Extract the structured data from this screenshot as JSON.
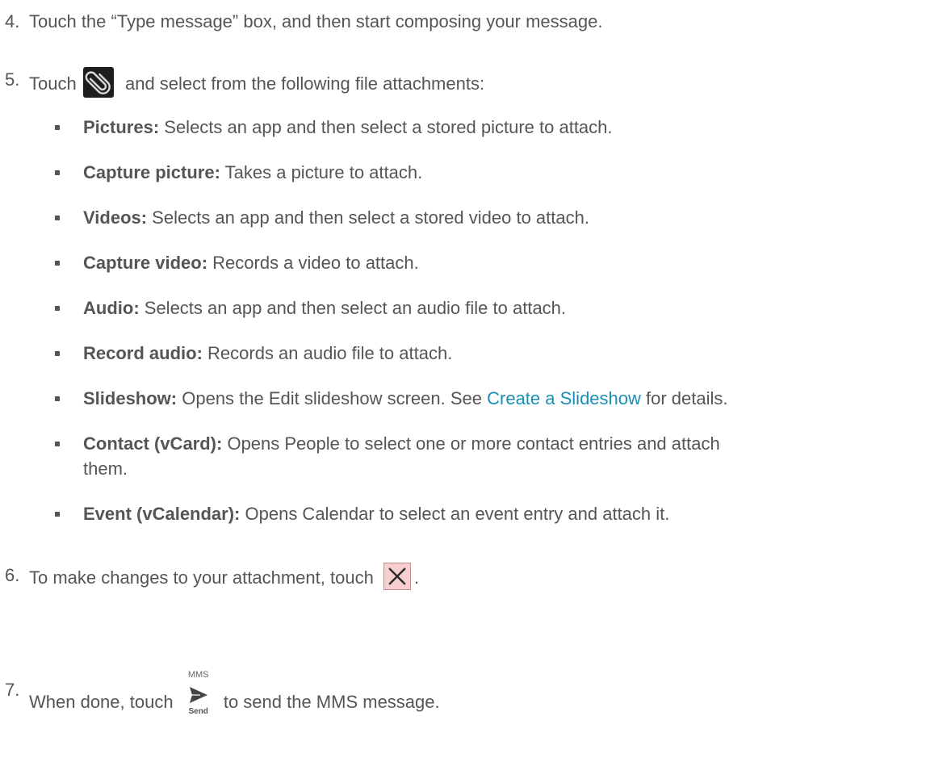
{
  "steps": {
    "s4": {
      "num": "4.",
      "text": "Touch the “Type message” box, and then start composing your message."
    },
    "s5": {
      "num": "5.",
      "before": "Touch",
      "after": "and select from the following file attachments:",
      "icon": "paperclip-icon"
    },
    "s6": {
      "num": "6.",
      "before": "To make changes to your attachment, touch",
      "after": ".",
      "icon": "close-icon"
    },
    "s7": {
      "num": "7.",
      "before": "When done, touch",
      "after": "to send the MMS message.",
      "icon": "send-icon",
      "icon_top_label": "MMS",
      "icon_bottom_label": "Send"
    }
  },
  "attachments": [
    {
      "term": "Pictures:",
      "desc": " Selects an app and then select a stored picture to attach."
    },
    {
      "term": "Capture picture:",
      "desc": " Takes a picture to attach."
    },
    {
      "term": "Videos:",
      "desc": " Selects an app and then select a stored video to attach."
    },
    {
      "term": "Capture video:",
      "desc": " Records a video to attach."
    },
    {
      "term": "Audio:",
      "desc": " Selects an app and then select an audio file to attach."
    },
    {
      "term": "Record audio:",
      "desc": " Records an audio file to attach."
    },
    {
      "term": "Slideshow:",
      "desc": " Opens the Edit slideshow screen. See ",
      "link": "Create a Slideshow",
      "after_link": " for details."
    },
    {
      "term": "Contact (vCard):",
      "desc": " Opens People to select one or more contact entries and attach",
      "continuation": "them."
    },
    {
      "term": "Event (vCalendar):",
      "desc": " Opens Calendar to select an event entry and attach it."
    }
  ],
  "colors": {
    "text": "#555555",
    "link": "#1a8fb5",
    "close_icon_bg": "#f7cfcf",
    "clip_icon_bg": "#1e1e1e"
  }
}
